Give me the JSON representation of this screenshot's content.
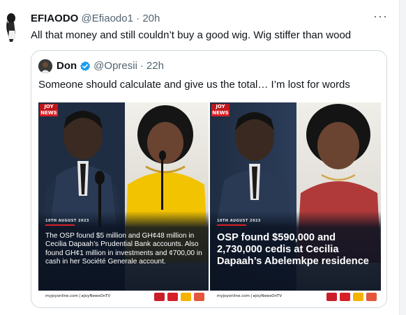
{
  "tweet": {
    "author_name": "EFIAODO",
    "author_handle": "@Efiaodo1",
    "separator": "·",
    "time": "20h",
    "text": "All that money and still couldn’t buy a good wig. Wig stiffer than wood",
    "more_icon": "more-icon"
  },
  "quote": {
    "author_name": "Don",
    "author_handle": "@Opresii",
    "separator": "·",
    "time": "22h",
    "verified_icon": "verified-badge-icon",
    "text": "Someone should calculate and give us the total… I’m lost for words"
  },
  "media": [
    {
      "brand_top": "JOY",
      "brand_bottom": "NEWS",
      "date": "10TH AUGUST 2023",
      "caption": "The OSP found $5 million and GH¢48 million in Cecilia Dapaah’s Prudential Bank accounts. Also found GH¢1 million in investments and ¢700,00 in cash in her Société Generale account.",
      "footer_site": "myjoyonline.com | ▸JoyNewsOnTV"
    },
    {
      "brand_top": "JOY",
      "brand_bottom": "NEWS",
      "date": "10TH AUGUST 2023",
      "caption": "OSP found $590,000 and 2,730,000 cedis at Cecilia Dapaah’s Abelemkpe residence",
      "footer_site": "myjoyonline.com | ▸JoyNewsOnTV"
    }
  ],
  "colors": {
    "text_primary": "#0f1419",
    "text_secondary": "#536471",
    "verified_blue": "#1d9bf0",
    "joy_red": "#d61f26",
    "overlay_navy": "#0b1322"
  }
}
